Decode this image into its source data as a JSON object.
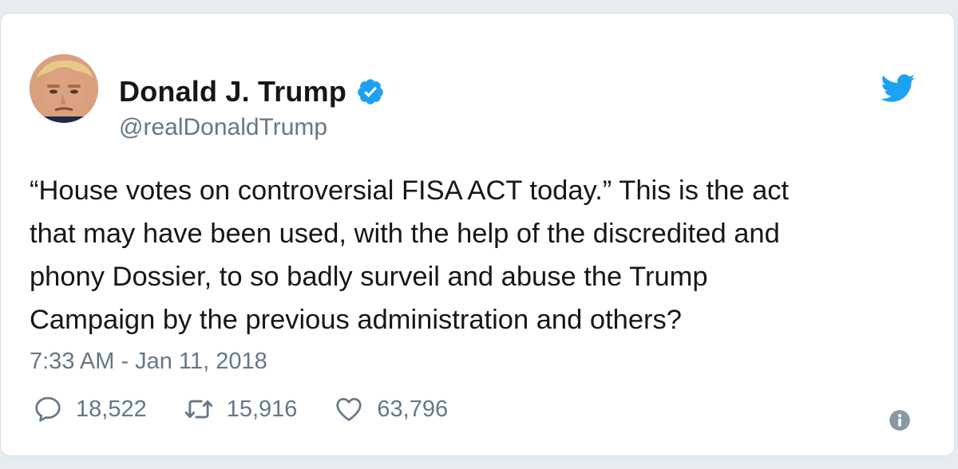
{
  "author": {
    "name": "Donald J. Trump",
    "handle": "@realDonaldTrump",
    "verified": true
  },
  "tweet": {
    "text": "“House votes on controversial FISA ACT today.” This is the act\nthat may have been used, with the help of the discredited and\nphony Dossier, to so badly surveil and abuse the Trump\nCampaign by the previous administration and others?",
    "timestamp": "7:33 AM - Jan 11, 2018"
  },
  "actions": {
    "replies": "18,522",
    "retweets": "15,916",
    "likes": "63,796"
  },
  "icons": {
    "brand": "twitter-bird-icon",
    "verified": "verified-badge-icon",
    "reply": "reply-icon",
    "retweet": "retweet-icon",
    "like": "heart-icon",
    "info": "info-icon"
  },
  "colors": {
    "brand_blue": "#1da1f2",
    "text": "#14171a",
    "muted": "#657786",
    "background": "#e6ecf0"
  }
}
